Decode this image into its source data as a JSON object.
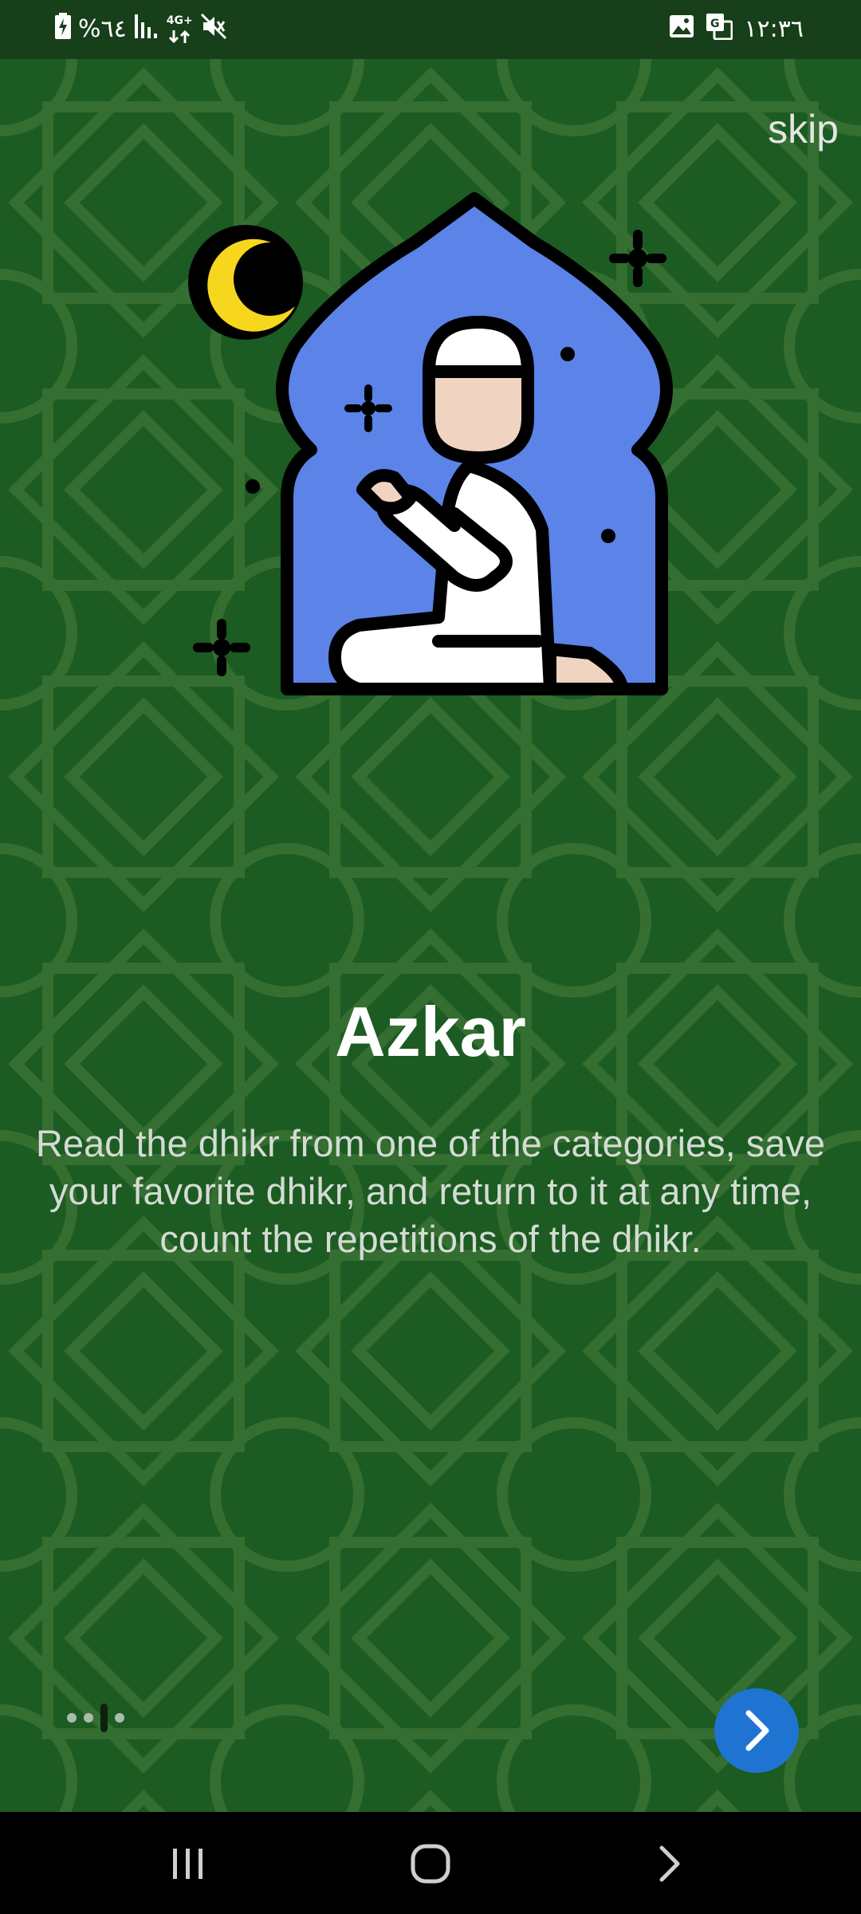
{
  "status_bar": {
    "battery_text": "%٦٤",
    "network_type": "4G+",
    "time": "١٢:٣٦",
    "icons": [
      "battery-charging-icon",
      "signal-icon",
      "network-4g-icon",
      "mute-icon",
      "gallery-icon",
      "translate-icon"
    ]
  },
  "onboarding": {
    "skip_label": "skip",
    "title": "Azkar",
    "description": "Read the dhikr from one of the categories, save your favorite dhikr, and return to it at any time, count the repetitions of the dhikr.",
    "illustration_icon": "praying-man-mihrab-icon",
    "page_count": 4,
    "current_page": 3,
    "next_icon": "chevron-right-icon"
  },
  "nav_bar": {
    "icons": [
      "recent-apps-icon",
      "home-icon",
      "back-icon"
    ]
  },
  "colors": {
    "background": "#1c5b22",
    "status_bar": "#173f1a",
    "accent_button": "#1f74d1",
    "mihrab_blue": "#5b83e8",
    "moon_yellow": "#f7d61e"
  }
}
